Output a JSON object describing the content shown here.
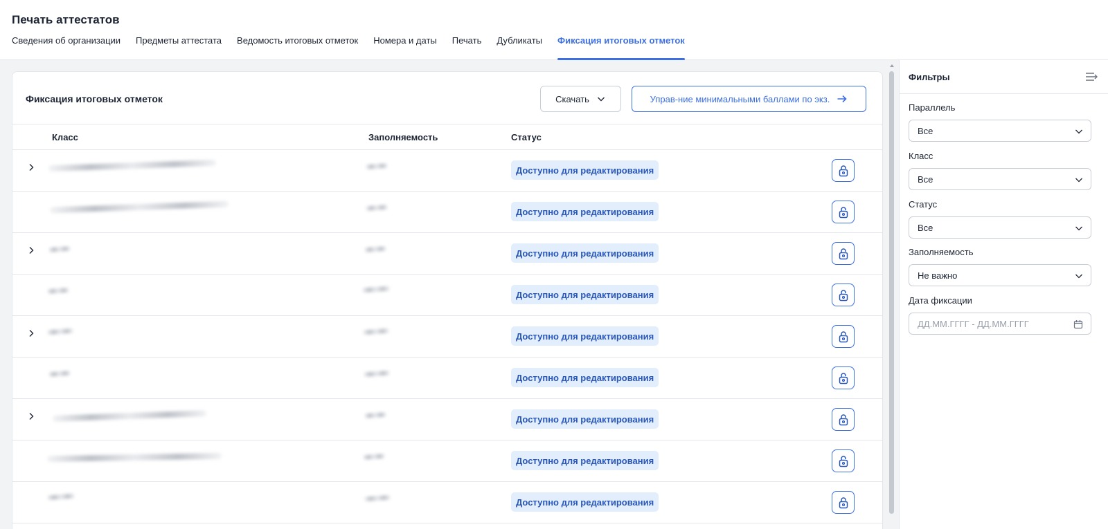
{
  "header": {
    "title": "Печать аттестатов",
    "tabs": [
      {
        "label": "Сведения об организации"
      },
      {
        "label": "Предметы аттестата"
      },
      {
        "label": "Ведомость итоговых отметок"
      },
      {
        "label": "Номера и даты"
      },
      {
        "label": "Печать"
      },
      {
        "label": "Дубликаты"
      },
      {
        "label": "Фиксация итоговых отметок",
        "active": true
      }
    ]
  },
  "card": {
    "title": "Фиксация итоговых отметок",
    "download_label": "Скачать",
    "manage_label": "Управ-ние минимальными баллами по экз.",
    "columns": {
      "class": "Класс",
      "fill": "Заполняемость",
      "status": "Статус"
    },
    "rows": [
      {
        "expandable": true,
        "status": "Доступно для редактирования"
      },
      {
        "expandable": false,
        "status": "Доступно для редактирования"
      },
      {
        "expandable": true,
        "status": "Доступно для редактирования"
      },
      {
        "expandable": false,
        "status": "Доступно для редактирования"
      },
      {
        "expandable": true,
        "status": "Доступно для редактирования"
      },
      {
        "expandable": false,
        "status": "Доступно для редактирования"
      },
      {
        "expandable": true,
        "status": "Доступно для редактирования"
      },
      {
        "expandable": false,
        "status": "Доступно для редактирования"
      },
      {
        "expandable": false,
        "status": "Доступно для редактирования"
      }
    ]
  },
  "filters": {
    "title": "Фильтры",
    "parallel": {
      "label": "Параллель",
      "value": "Все"
    },
    "class": {
      "label": "Класс",
      "value": "Все"
    },
    "status": {
      "label": "Статус",
      "value": "Все"
    },
    "fill": {
      "label": "Заполняемость",
      "value": "Не важно"
    },
    "date": {
      "label": "Дата фиксации",
      "placeholder": "ДД.ММ.ГГГГ - ДД.ММ.ГГГГ"
    }
  },
  "colors": {
    "accent": "#3d6fe0",
    "badge_bg": "#e3eefc",
    "badge_text": "#2857b8"
  }
}
